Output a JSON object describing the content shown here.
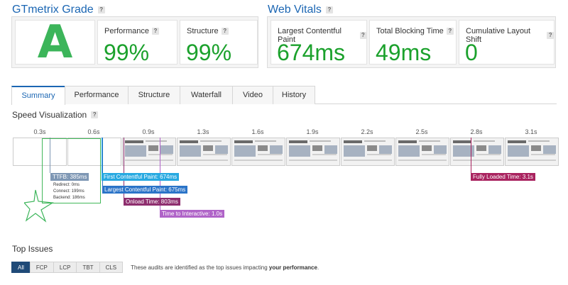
{
  "grade": {
    "title": "GTmetrix Grade",
    "letter": "A",
    "performance": {
      "label": "Performance",
      "value": "99%"
    },
    "structure": {
      "label": "Structure",
      "value": "99%"
    }
  },
  "web_vitals": {
    "title": "Web Vitals",
    "lcp": {
      "label": "Largest Contentful Paint",
      "value": "674ms"
    },
    "tbt": {
      "label": "Total Blocking Time",
      "value": "49ms"
    },
    "cls": {
      "label": "Cumulative Layout Shift",
      "value": "0"
    }
  },
  "tabs": [
    "Summary",
    "Performance",
    "Structure",
    "Waterfall",
    "Video",
    "History"
  ],
  "speed": {
    "title": "Speed Visualization",
    "times": [
      "0.3s",
      "0.6s",
      "0.9s",
      "1.3s",
      "1.6s",
      "1.9s",
      "2.2s",
      "2.5s",
      "2.8s",
      "3.1s"
    ],
    "ttfb": "TTFB: 385ms",
    "redirect": "Redirect: 0ms",
    "connect": "Connect: 199ms",
    "backend": "Backend: 186ms",
    "fcp": "First Contentful Paint: 674ms",
    "lcp": "Largest Contentful Paint: 675ms",
    "onload": "Onload Time: 803ms",
    "tti": "Time to Interactive: 1.0s",
    "fully_loaded": "Fully Loaded Time: 3.1s"
  },
  "top_issues": {
    "title": "Top Issues",
    "filters": [
      "All",
      "FCP",
      "LCP",
      "TBT",
      "CLS"
    ],
    "note_prefix": "These audits are identified as the top issues impacting ",
    "note_bold": "your performance",
    "note_suffix": "."
  },
  "colors": {
    "accent": "#1b66b3",
    "good": "#1ba12c",
    "fcp": "#27a9e1",
    "lcp": "#2b74c8",
    "onload": "#8e2e6e",
    "tti": "#b064c8",
    "fully": "#a9235f",
    "ttfb": "#7e97b4"
  }
}
